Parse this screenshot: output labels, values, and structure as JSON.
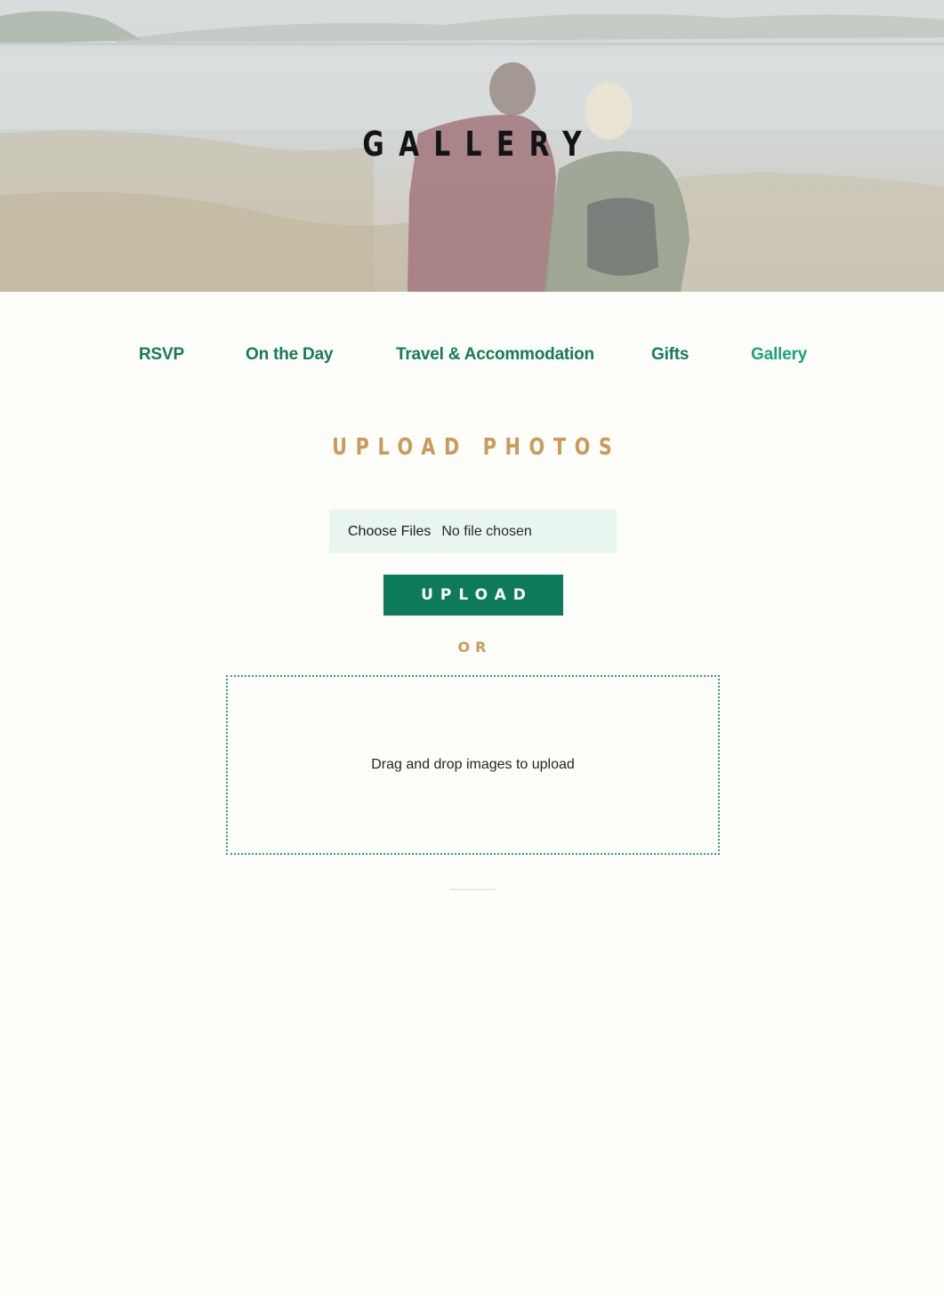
{
  "hero": {
    "title": "GALLERY"
  },
  "nav": {
    "items": [
      {
        "label": "RSVP"
      },
      {
        "label": "On the Day"
      },
      {
        "label": "Travel & Accommodation"
      },
      {
        "label": "Gifts"
      },
      {
        "label": "Gallery",
        "active": true
      }
    ]
  },
  "upload": {
    "title": "UPLOAD PHOTOS",
    "choose_files_label": "Choose Files",
    "file_status": "No file chosen",
    "upload_button_label": "UPLOAD",
    "or_label": "OR",
    "dropzone_text": "Drag and drop images to upload"
  },
  "colors": {
    "nav_link": "#147a5d",
    "nav_active": "#1aa27c",
    "accent_gold": "#c99a5b",
    "button_green": "#0c7a5b",
    "page_background": "#fdfef9"
  }
}
